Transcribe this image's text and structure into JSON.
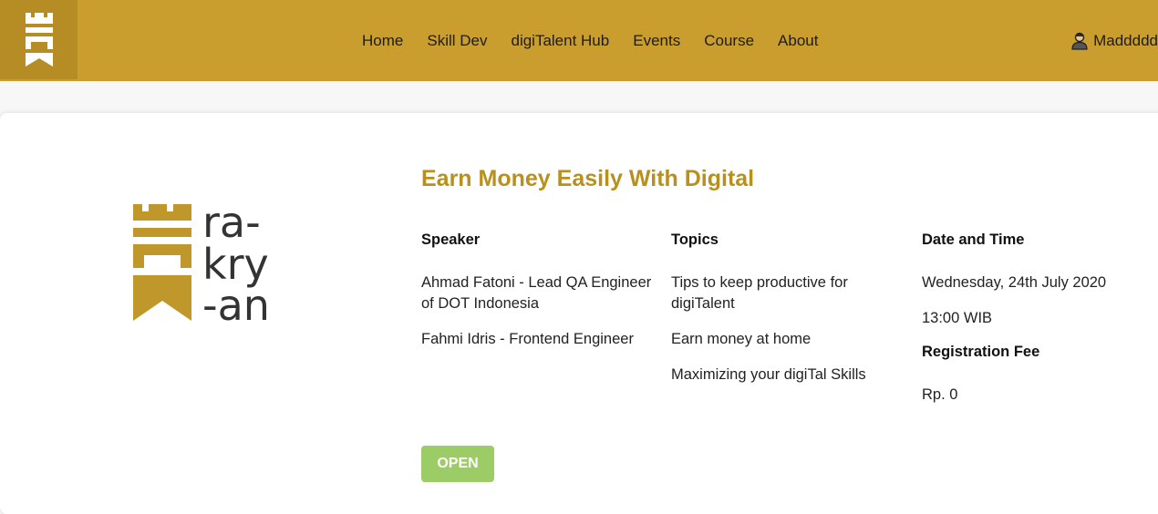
{
  "nav": {
    "links": [
      "Home",
      "Skill Dev",
      "digiTalent Hub",
      "Events",
      "Course",
      "About"
    ],
    "user_icon": "user-avatar-icon",
    "user_name": "Maddddd"
  },
  "brand": {
    "icon": "castle-logo-icon",
    "logo_text": [
      "ra-",
      "kry",
      "-an"
    ]
  },
  "event": {
    "title": "Earn Money Easily With Digital",
    "speaker": {
      "heading": "Speaker",
      "items": [
        "Ahmad Fatoni - Lead QA Engineer of DOT Indonesia",
        "Fahmi Idris - Frontend Engineer"
      ]
    },
    "topics": {
      "heading": "Topics",
      "items": [
        "Tips to keep productive for digiTalent",
        "Earn money at home",
        "Maximizing your digiTal Skills"
      ]
    },
    "datetime": {
      "heading": "Date and Time",
      "date": "Wednesday, 24th July 2020",
      "time": "13:00 WIB"
    },
    "fee": {
      "heading": "Registration Fee",
      "value": "Rp. 0"
    },
    "status_button": "OPEN"
  },
  "colors": {
    "navbar": "#c99d2e",
    "brand_box": "#b68c25",
    "title": "#b8901e",
    "open_button": "#9ccc65",
    "logo_gold": "#c0972a",
    "logo_dark": "#333333"
  }
}
